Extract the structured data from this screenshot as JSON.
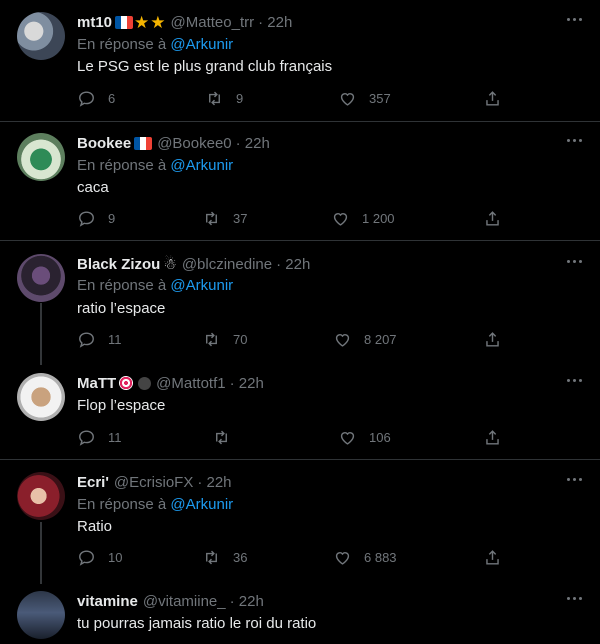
{
  "colors": {
    "bg": "#000000",
    "text": "#e7e9ea",
    "muted": "#71767b",
    "mention": "#1d9bf0",
    "divider": "#2f3336"
  },
  "reply_prefix": "En réponse à",
  "tweets": [
    {
      "name": "mt10",
      "emoji": [
        "flag-france",
        "star",
        "star"
      ],
      "handle": "@Matteo_trr",
      "time": "· 22h",
      "reply_to": "@Arkunir",
      "text": "Le PSG est le plus grand club français",
      "replies": "6",
      "retweets": "9",
      "likes": "357"
    },
    {
      "name": "Bookee",
      "emoji": [
        "flag-france"
      ],
      "handle": "@Bookee0",
      "time": "· 22h",
      "reply_to": "@Arkunir",
      "text": "caca",
      "replies": "9",
      "retweets": "37",
      "likes": "1 200"
    },
    {
      "name": "Black Zizou",
      "emoji": [
        "snowman"
      ],
      "handle": "@blczinedine",
      "time": "· 22h",
      "reply_to": "@Arkunir",
      "text": "ratio l’espace",
      "replies": "11",
      "retweets": "70",
      "likes": "8 207"
    },
    {
      "name": "MaTT",
      "emoji": [
        "target",
        "ninja"
      ],
      "handle": "@Mattotf1",
      "time": "· 22h",
      "reply_to": "",
      "text": "Flop l’espace",
      "replies": "11",
      "retweets": "",
      "likes": "106"
    },
    {
      "name": "Ecri'",
      "emoji": [],
      "handle": "@EcrisioFX",
      "time": "· 22h",
      "reply_to": "@Arkunir",
      "text": "Ratio",
      "replies": "10",
      "retweets": "36",
      "likes": "6 883"
    },
    {
      "name": "vitamine",
      "emoji": [],
      "handle": "@vitamiine_",
      "time": "· 22h",
      "reply_to": "",
      "text": "tu pourras jamais ratio le roi du ratio",
      "replies": "",
      "retweets": "",
      "likes": ""
    }
  ]
}
